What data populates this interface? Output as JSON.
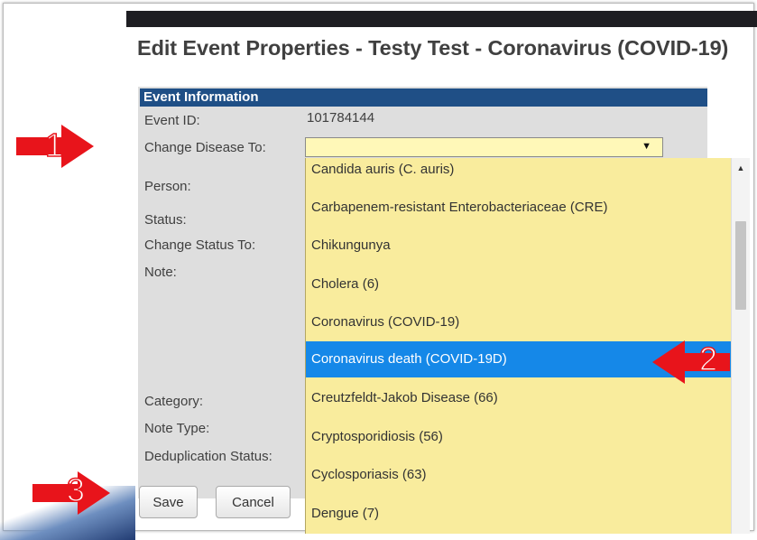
{
  "title": "Edit Event Properties - Testy Test - Coronavirus (COVID-19)",
  "section": {
    "header": "Event Information"
  },
  "fields": {
    "event_id_label": "Event ID:",
    "event_id_value": "101784144",
    "change_disease_label": "Change Disease To:",
    "change_disease_value": "",
    "person_label": "Person:",
    "status_label": "Status:",
    "change_status_label": "Change Status To:",
    "note_label": "Note:",
    "category_label": "Category:",
    "note_type_label": "Note Type:",
    "dedup_label": "Deduplication Status:"
  },
  "dropdown": {
    "options": [
      "Candida auris (C. auris)",
      "Carbapenem-resistant Enterobacteriaceae (CRE)",
      "Chikungunya",
      "Cholera (6)",
      "Coronavirus (COVID-19)",
      "Coronavirus death (COVID-19D)",
      "Creutzfeldt-Jakob Disease (66)",
      "Cryptosporidiosis (56)",
      "Cyclosporiasis (63)",
      "Dengue (7)"
    ],
    "selected": "Coronavirus death (COVID-19D)"
  },
  "buttons": {
    "save": "Save",
    "cancel": "Cancel"
  },
  "annotations": {
    "step1": "1",
    "step2": "2",
    "step3": "3"
  },
  "colors": {
    "section_header": "#1f4f86",
    "dropdown_bg": "#f9ec9d",
    "selected_bg": "#1588e8",
    "arrow": "#e8141b"
  },
  "icons": {
    "select_caret": "▼",
    "scroll_up": "▲"
  }
}
